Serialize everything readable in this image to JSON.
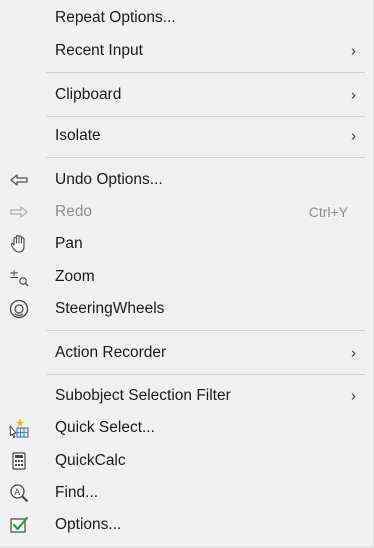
{
  "menu": {
    "items": [
      {
        "label": "Repeat Options..."
      },
      {
        "label": "Recent Input",
        "arrow": "›"
      },
      {
        "label": "Clipboard",
        "arrow": "›"
      },
      {
        "label": "Isolate",
        "arrow": "›"
      },
      {
        "label": "Undo Options...",
        "icon": "undo-arrow-icon"
      },
      {
        "label": "Redo",
        "shortcut": "Ctrl+Y",
        "icon": "redo-arrow-icon",
        "disabled": true
      },
      {
        "label": "Pan",
        "icon": "hand-pan-icon"
      },
      {
        "label": "Zoom",
        "icon": "zoom-icon"
      },
      {
        "label": "SteeringWheels",
        "icon": "steering-wheel-icon"
      },
      {
        "label": "Action Recorder",
        "arrow": "›"
      },
      {
        "label": "Subobject Selection Filter",
        "arrow": "›"
      },
      {
        "label": "Quick Select...",
        "icon": "quick-select-icon"
      },
      {
        "label": "QuickCalc",
        "icon": "calculator-icon"
      },
      {
        "label": "Find...",
        "icon": "find-icon"
      },
      {
        "label": "Options...",
        "icon": "options-check-icon"
      }
    ]
  }
}
